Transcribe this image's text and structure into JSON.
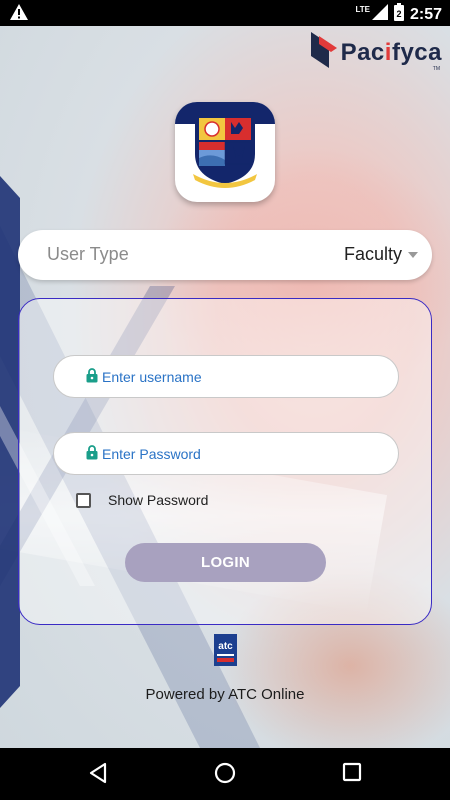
{
  "status_bar": {
    "network_label": "LTE",
    "battery_level": "2",
    "time": "2:57",
    "icons": [
      "warning-icon",
      "signal-icon",
      "battery-icon"
    ]
  },
  "brand": {
    "prefix": "Pac",
    "highlight": "i",
    "suffix": "fyca",
    "trademark": "TM"
  },
  "user_type": {
    "label": "User Type",
    "selected": "Faculty"
  },
  "login_form": {
    "username_placeholder": "Enter username",
    "password_placeholder": "Enter Password",
    "show_password_label": "Show Password",
    "show_password_checked": false,
    "login_button": "LOGIN"
  },
  "footer": {
    "atc_logo_text": "atc",
    "powered_by": "Powered by ATC Online"
  },
  "colors": {
    "accent_blue": "#2a73c6",
    "card_border": "#3a2bc4",
    "login_button_bg": "#a8a1bf",
    "crest_navy": "#13266b",
    "brand_red": "#e23a3a"
  }
}
